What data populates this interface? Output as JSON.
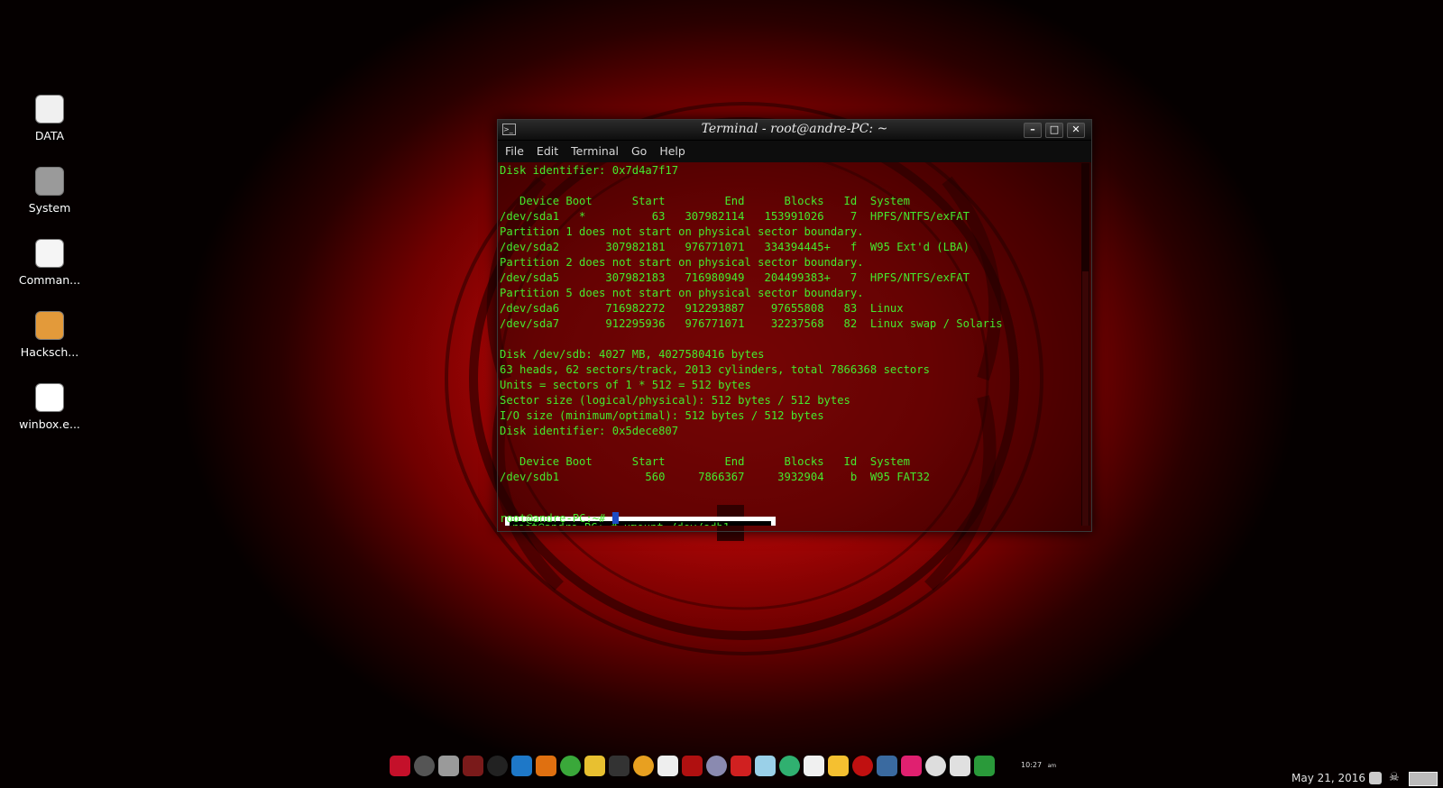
{
  "desktop": {
    "icons": [
      {
        "label": "DATA",
        "icon": "drive-icon",
        "color": "#f0f0f0"
      },
      {
        "label": "System",
        "icon": "drive-icon",
        "color": "#9a9a9a"
      },
      {
        "label": "Comman...",
        "icon": "text-file-icon",
        "color": "#f5f5f5"
      },
      {
        "label": "Hacksch...",
        "icon": "package-icon",
        "color": "#e39a3a"
      },
      {
        "label": "winbox.e...",
        "icon": "exe-icon",
        "color": "#ffffff"
      }
    ]
  },
  "terminal": {
    "title": "Terminal - root@andre-PC: ~",
    "menu": [
      "File",
      "Edit",
      "Terminal",
      "Go",
      "Help"
    ],
    "lines": [
      "Disk identifier: 0x7d4a7f17",
      "",
      "   Device Boot      Start         End      Blocks   Id  System",
      "/dev/sda1   *          63   307982114   153991026    7  HPFS/NTFS/exFAT",
      "Partition 1 does not start on physical sector boundary.",
      "/dev/sda2       307982181   976771071   334394445+   f  W95 Ext'd (LBA)",
      "Partition 2 does not start on physical sector boundary.",
      "/dev/sda5       307982183   716980949   204499383+   7  HPFS/NTFS/exFAT",
      "Partition 5 does not start on physical sector boundary.",
      "/dev/sda6       716982272   912293887    97655808   83  Linux",
      "/dev/sda7       912295936   976771071    32237568   82  Linux swap / Solaris",
      "",
      "Disk /dev/sdb: 4027 MB, 4027580416 bytes",
      "63 heads, 62 sectors/track, 2013 cylinders, total 7866368 sectors",
      "Units = sectors of 1 * 512 = 512 bytes",
      "Sector size (logical/physical): 512 bytes / 512 bytes",
      "I/O size (minimum/optimal): 512 bytes / 512 bytes",
      "Disk identifier: 0x5dece807",
      "",
      "   Device Boot      Start         End      Blocks   Id  System",
      "/dev/sdb1             560     7866367     3932904    b  W95 FAT32"
    ],
    "highlighted_lines": [
      "root@andre-PC:~# umount /dev/sdb1",
      "mount: /dev/sdb1: not mounted"
    ],
    "prompt": "root@andre-PC:~# ",
    "text_color": "#45ea2e"
  },
  "dock": {
    "items": [
      {
        "icon": "anchor-icon",
        "color": "#c4102a"
      },
      {
        "icon": "globe-icon",
        "color": "#555555"
      },
      {
        "icon": "cloud-icon",
        "color": "#9a9a9a"
      },
      {
        "icon": "task-manager-icon",
        "color": "#7a1a1a"
      },
      {
        "icon": "terminal-icon",
        "color": "#222222"
      },
      {
        "icon": "oscilloscope-icon",
        "color": "#1e78c8"
      },
      {
        "icon": "waveform-icon",
        "color": "#e07010"
      },
      {
        "icon": "toggle-icon",
        "color": "#3aa83a"
      },
      {
        "icon": "notes-icon",
        "color": "#e8c030"
      },
      {
        "icon": "camera-icon",
        "color": "#333333"
      },
      {
        "icon": "stack-icon",
        "color": "#e8a020"
      },
      {
        "icon": "pen-icon",
        "color": "#eeeeee"
      },
      {
        "icon": "antenna-icon",
        "color": "#b01010"
      },
      {
        "icon": "film-reel-icon",
        "color": "#8a8ab0"
      },
      {
        "icon": "virus-icon",
        "color": "#d02020"
      },
      {
        "icon": "eye-icon",
        "color": "#9ad0e8"
      },
      {
        "icon": "lightning-icon",
        "color": "#30b070"
      },
      {
        "icon": "usb-icon",
        "color": "#f0f0f0"
      },
      {
        "icon": "sticky-note-icon",
        "color": "#f5c030"
      },
      {
        "icon": "hacker-mask-icon",
        "color": "#c01010"
      },
      {
        "icon": "keyhole-icon",
        "color": "#3a6aa0"
      },
      {
        "icon": "speaker-icon",
        "color": "#e02070"
      },
      {
        "icon": "anonymous-icon",
        "color": "#dddddd"
      },
      {
        "icon": "trash-icon",
        "color": "#e0e0e0"
      },
      {
        "icon": "orb-icon",
        "color": "#2a9a3a"
      }
    ],
    "clock": "10:27",
    "clock_suffix": "am"
  },
  "tray": {
    "date": "May 21, 2016",
    "icons": [
      "refresh-icon",
      "pirate-icon",
      "battery-icon"
    ]
  }
}
